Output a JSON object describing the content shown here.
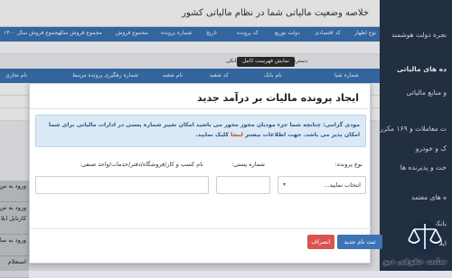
{
  "sidebar": {
    "items": [
      {
        "label": "نجره دولت هوشمند"
      },
      {
        "label": "ده های مالیاتی"
      },
      {
        "label": "و منابع مالیاتی"
      },
      {
        "label": "ت معاملات و ۱۶۹ مکرر"
      },
      {
        "label": "ک و خودرو"
      },
      {
        "label": "خت و پذیرنده ها"
      },
      {
        "label": "ه های معتمد"
      },
      {
        "label": "بانکی"
      },
      {
        "label": "ابلاغیه های"
      }
    ]
  },
  "header": {
    "title": "خلاصه وضعیت مالیاتی شما در نظام مالیاتی کشور"
  },
  "summary_table": {
    "columns": [
      "نوع اظهار",
      "کد اقتصادی",
      "دولت توزیع",
      "کد پرونده",
      "تاریخ",
      "شماره پرونده",
      "مجموع فروش",
      "مجموع فروش سال",
      "مجموع فروش سال ۱۴۰۰"
    ]
  },
  "bank_section": {
    "title": "دسترسی سریع به حساب های بانکی",
    "show_all_button": "نمایش فهرست کامل",
    "columns": [
      "شماره شبا",
      "نام بانک",
      "کد شعبه",
      "نام شعبه",
      "شماره رهگیری پرونده مرتبط",
      "نام تجاری"
    ]
  },
  "left_tabs": [
    {
      "label": "ورود به س"
    },
    {
      "label": "ورود به س"
    },
    {
      "label": "کارتابل ابلا"
    },
    {
      "label": "ورود به سام"
    },
    {
      "label": "استعلام"
    }
  ],
  "modal": {
    "title": "ایجاد پرونده مالیات بر درآمد جدید",
    "alert_text": "مودی گرامی: چنانچه شما جزء مودیان مجوز محور می باشید امکان تغییر شماره پستی در ادارات مالیاتی برای شما امکان پذیر می باشد. جهت اطلاعات بیشتر",
    "alert_link": "اینجا",
    "alert_suffix": "کلیک نمایید.",
    "fields": {
      "file_type_label": "نوع پرونده:",
      "file_type_value": "انتخاب نمایید...",
      "postal_code_label": "شماره پستی:",
      "postal_code_value": "",
      "business_name_label": "نام کسب و کار/فروشگاه/دفتر/خدمات/واحد صنفی:",
      "business_name_value": ""
    },
    "submit_button": "ثبت نام جدید",
    "cancel_button": "انصراف"
  },
  "watermark": {
    "text": "سایت حقوقی دیو"
  },
  "colors": {
    "primary": "#3b73b5",
    "danger": "#d9534f",
    "sidebar": "#27364a",
    "alert_bg": "#dbe9f6"
  }
}
